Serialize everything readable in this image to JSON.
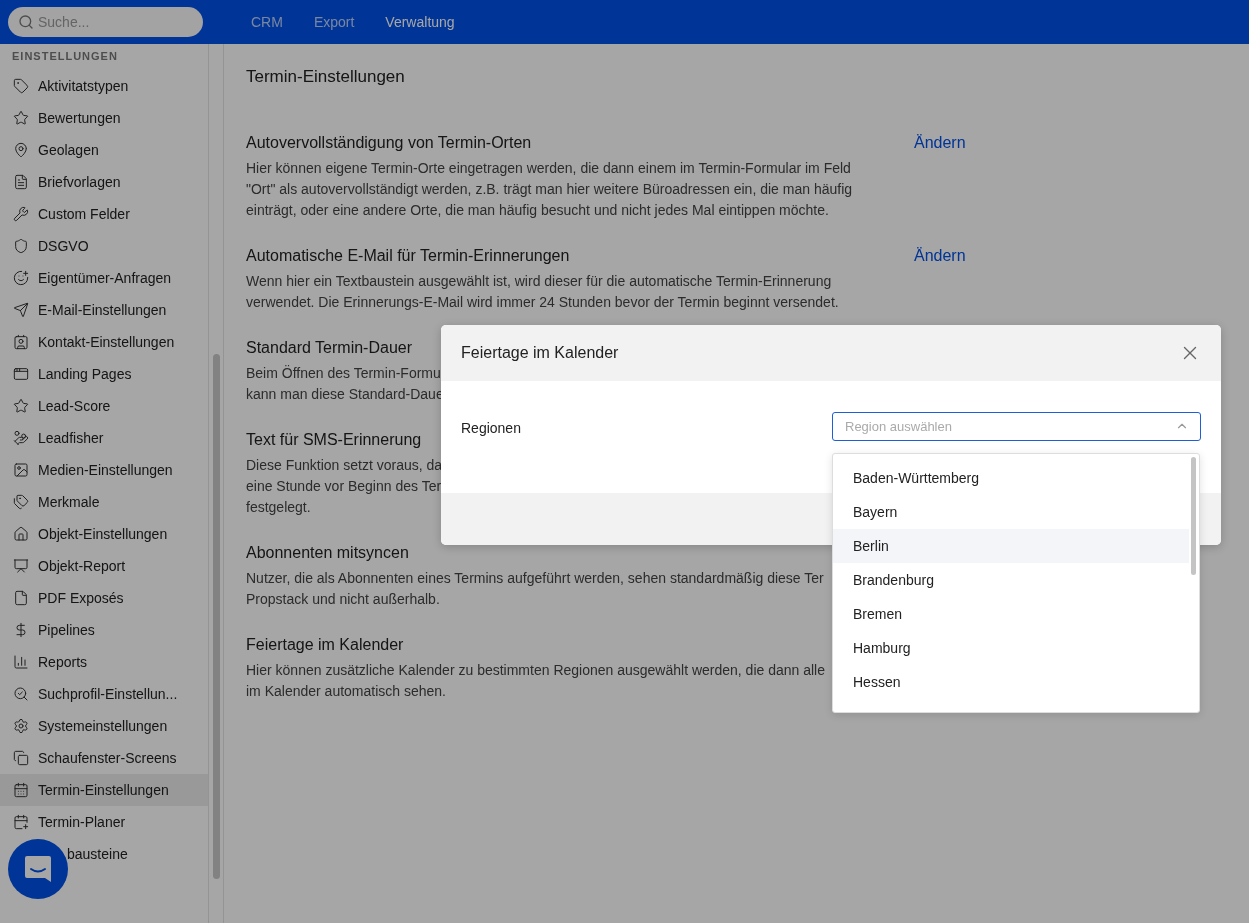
{
  "topbar": {
    "search": {
      "placeholder": "Suche..."
    },
    "tabs": [
      {
        "label": "CRM",
        "selected": false
      },
      {
        "label": "Export",
        "selected": false
      },
      {
        "label": "Verwaltung",
        "selected": true
      }
    ]
  },
  "sidebar": {
    "heading": "EINSTELLUNGEN",
    "items": [
      {
        "label": "Aktivitatstypen",
        "selected": false
      },
      {
        "label": "Bewertungen",
        "selected": false
      },
      {
        "label": "Geolagen",
        "selected": false
      },
      {
        "label": "Briefvorlagen",
        "selected": false
      },
      {
        "label": "Custom Felder",
        "selected": false
      },
      {
        "label": "DSGVO",
        "selected": false
      },
      {
        "label": "Eigentümer-Anfragen",
        "selected": false
      },
      {
        "label": "E-Mail-Einstellungen",
        "selected": false
      },
      {
        "label": "Kontakt-Einstellungen",
        "selected": false
      },
      {
        "label": "Landing Pages",
        "selected": false
      },
      {
        "label": "Lead-Score",
        "selected": false
      },
      {
        "label": "Leadfisher",
        "selected": false
      },
      {
        "label": "Medien-Einstellungen",
        "selected": false
      },
      {
        "label": "Merkmale",
        "selected": false
      },
      {
        "label": "Objekt-Einstellungen",
        "selected": false
      },
      {
        "label": "Objekt-Report",
        "selected": false
      },
      {
        "label": "PDF Exposés",
        "selected": false
      },
      {
        "label": "Pipelines",
        "selected": false
      },
      {
        "label": "Reports",
        "selected": false
      },
      {
        "label": "Suchprofil-Einstellun...",
        "selected": false
      },
      {
        "label": "Systemeinstellungen",
        "selected": false
      },
      {
        "label": "Schaufenster-Screens",
        "selected": false
      },
      {
        "label": "Termin-Einstellungen",
        "selected": true
      },
      {
        "label": "Termin-Planer",
        "selected": false
      },
      {
        "label": "bausteine",
        "selected": false
      }
    ]
  },
  "page": {
    "title": "Termin-Einstellungen",
    "sections": [
      {
        "heading": "Autovervollständigung von Termin-Orten",
        "action": "Ändern",
        "lines": [
          "Hier können eigene Termin-Orte eingetragen werden, die dann einem im Termin-Formular im Feld",
          "\"Ort\" als autovervollständigt werden, z.B. trägt man hier weitere Büroadressen ein, die man häufig",
          "einträgt, oder eine andere Orte, die man häufig besucht und nicht jedes Mal eintippen möchte."
        ]
      },
      {
        "heading": "Automatische E-Mail für Termin-Erinnerungen",
        "action": "Ändern",
        "lines": [
          "Wenn hier ein Textbaustein ausgewählt ist, wird dieser für die automatische Termin-Erinnerung",
          "verwendet. Die Erinnerungs-E-Mail wird immer 24 Stunden bevor der Termin beginnt versendet."
        ]
      },
      {
        "heading": "Standard Termin-Dauer",
        "lines": [
          "Beim Öffnen des Termin-Formu",
          "kann man diese Standard-Daue"
        ]
      },
      {
        "heading": "Text für SMS-Erinnerung",
        "lines": [
          "Diese Funktion setzt voraus, da",
          "eine Stunde vor Beginn des Ter",
          "festgelegt."
        ]
      },
      {
        "heading": "Abonnenten mitsyncen",
        "lines": [
          "Nutzer, die als Abonnenten eines Termins aufgeführt werden, sehen standardmäßig diese Ter",
          "Propstack und nicht außerhalb."
        ]
      },
      {
        "heading": "Feiertage im Kalender",
        "lines": [
          "Hier können zusätzliche Kalender zu bestimmten Regionen ausgewählt werden, die dann alle",
          "im Kalender automatisch sehen."
        ]
      }
    ]
  },
  "modal": {
    "title": "Feiertage im Kalender",
    "field_label": "Regionen",
    "select": {
      "placeholder": "Region auswählen",
      "expanded": true
    },
    "options": [
      {
        "label": "Baden-Württemberg",
        "selected": false
      },
      {
        "label": "Bayern",
        "selected": false
      },
      {
        "label": "Berlin",
        "selected": true
      },
      {
        "label": "Brandenburg",
        "selected": false
      },
      {
        "label": "Bremen",
        "selected": false
      },
      {
        "label": "Hamburg",
        "selected": false
      },
      {
        "label": "Hessen",
        "selected": false
      }
    ]
  }
}
